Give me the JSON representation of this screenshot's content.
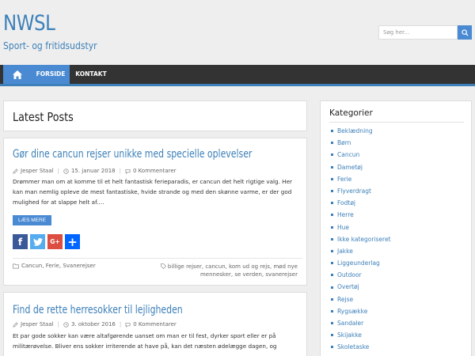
{
  "header": {
    "site_title": "NWSL",
    "tagline": "Sport- og fritidsudstyr",
    "search_placeholder": "Søg her..."
  },
  "nav": {
    "items": [
      {
        "label": "FORSIDE"
      },
      {
        "label": "KONTAKT"
      }
    ]
  },
  "main": {
    "heading": "Latest Posts",
    "posts": [
      {
        "title": "Gør dine cancun rejser unikke med specielle oplevelser",
        "author": "Jesper Staal",
        "date": "15. januar 2018",
        "comments": "0 Kommentarer",
        "excerpt": "Drømmer man om at komme til et helt fantastisk ferieparadis, er cancun det helt rigtige valg. Her kan man nemlig opleve de mest fantastiske, hvide strande og med den skønne varme, er der god mulighed for at slappe helt af.…",
        "read_more": "LÆS MERE",
        "categories": "Cancun, Ferie, Svanerejser",
        "tags": "billige rejser, cancun, kom ud og rejs, mød nye mennesker, se verden, svanerejser"
      },
      {
        "title": "Find de rette herresokker til lejligheden",
        "author": "Jesper Staal",
        "date": "3. oktober 2016",
        "comments": "0 Kommentarer",
        "excerpt": "Et par gode sokker kan være altafgørende uanset om man er til fest, dyrker sport eller er på militærøvelse. Bliver ens sokker irriterende at have på, kan det næsten ødelægge dagen, og"
      }
    ]
  },
  "sidebar": {
    "title": "Kategorier",
    "categories": [
      "Beklædning",
      "Børn",
      "Cancun",
      "Dametøj",
      "Ferie",
      "Flyverdragt",
      "Fodtøj",
      "Herre",
      "Hue",
      "Ikke kategoriseret",
      "Jakke",
      "Liggeunderlag",
      "Outdoor",
      "Overtøj",
      "Rejse",
      "Rygsække",
      "Sandaler",
      "Skijakke",
      "Skoletaske"
    ]
  },
  "colors": {
    "accent": "#3d80b9",
    "nav_bg": "#333333",
    "button": "#4a8ad3"
  }
}
